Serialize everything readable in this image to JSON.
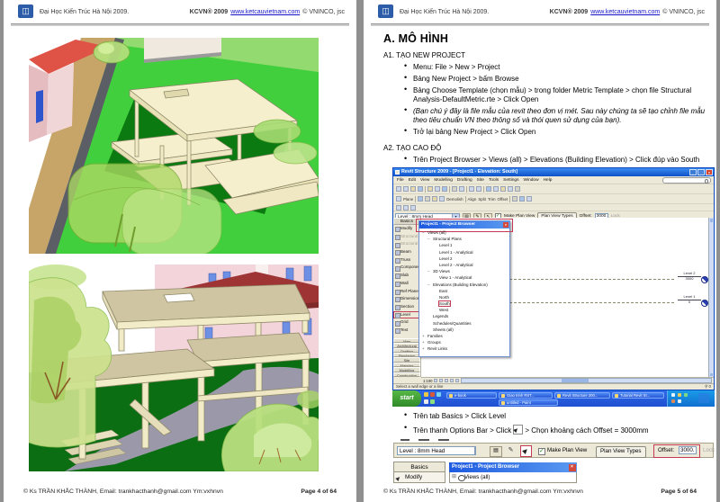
{
  "header": {
    "org": "Đại Học Kiến Trúc Hà Nội 2009.",
    "brand": "KCVN® 2009",
    "site": "www.ketcauvietnam.com",
    "copy": "© VNINCO, jsc"
  },
  "footer": {
    "author": "© Ks TRẦN KHẮC THÀNH, Email: trankhacthanh@gmail.com Ym:vxhnvn",
    "page_left": "Page 4 of 64",
    "page_right": "Page 5 of 64"
  },
  "doc": {
    "h1": "A. MÔ HÌNH",
    "a1_title": "A1. TẠO NEW PROJECT",
    "a1_b1": "Menu: File > New > Project",
    "a1_b2": "Bảng New Project > bấm Browse",
    "a1_b3": "Bảng Choose Template (chọn mẫu) > trong folder Metric Template > chọn file Structural Analysis-DefaultMetric.rte > Click Open",
    "a1_note": "(Bạn chú ý đây là file mẫu của revit theo đơn vị mét. Sau này chúng ta sẽ tạo chỉnh file mẫu theo tiêu chuẩn VN theo thông số và thói quen sử dụng của bạn).",
    "a1_b4": "Trở lại bảng New Project > Click Open",
    "a2_title": "A2. TẠO CAO ĐỘ",
    "a2_b1": "Trên Project Browser > Views (all) > Elevations (Building Elevation) > Click đúp vào South",
    "a2_b2": "Trên tab Basics > Click Level",
    "a2_b3_pre": "Trên thanh Options Bar > Click",
    "a2_b3_post": "> Chọn khoảng cách Offset = 3000mm"
  },
  "revit": {
    "title": "Revit Structure 2009 - [Project1 - Elevation: South]",
    "menus": [
      "File",
      "Edit",
      "View",
      "Modelling",
      "Drafting",
      "Site",
      "Tools",
      "Settings",
      "Window",
      "Help"
    ],
    "toolbar2_labels": [
      "Plane",
      "Demolish",
      "Align",
      "Split",
      "Trim",
      "Offset"
    ],
    "type_selector": "Level : 8mm Head",
    "options": {
      "make_plan_view": "Make Plan View",
      "plan_view_types": "Plan View Types",
      "offset_label": "Offset:",
      "offset_value": "3000.",
      "lock": "Lock"
    },
    "design_bar": {
      "tab": "Basics",
      "items": [
        "Modify",
        "Structural Wall",
        "Structural Column",
        "Beam",
        "Truss",
        "Component",
        "Slab",
        "Wall",
        "Ref Plane",
        "Dimension",
        "Section",
        "Level",
        "Grid",
        "Text"
      ],
      "tabs": [
        "View",
        "Architectural",
        "Drafting",
        "Rendering",
        "Site",
        "Massing",
        "Modelling",
        "Construction"
      ]
    },
    "browser": {
      "title": "Project1 - Project Browser",
      "tree": [
        {
          "label": "Views (all)",
          "d": 0
        },
        {
          "label": "Structural Plans",
          "d": 1
        },
        {
          "label": "Level 1",
          "d": 2
        },
        {
          "label": "Level 1 - Analytical",
          "d": 2
        },
        {
          "label": "Level 2",
          "d": 2
        },
        {
          "label": "Level 2 - Analytical",
          "d": 2
        },
        {
          "label": "3D Views",
          "d": 1
        },
        {
          "label": "View 1 - Analytical",
          "d": 2
        },
        {
          "label": "Elevations (Building Elevation)",
          "d": 1
        },
        {
          "label": "East",
          "d": 2
        },
        {
          "label": "North",
          "d": 2
        },
        {
          "label": "South",
          "d": 2
        },
        {
          "label": "West",
          "d": 2
        },
        {
          "label": "Legends",
          "d": 1
        },
        {
          "label": "Schedules/Quantities",
          "d": 1
        },
        {
          "label": "Sheets (all)",
          "d": 1
        },
        {
          "label": "Families",
          "d": 0
        },
        {
          "label": "Groups",
          "d": 0
        },
        {
          "label": "Revit Links",
          "d": 0
        }
      ]
    },
    "canvas": {
      "levels": [
        {
          "name": "Level 2",
          "elev": "3000"
        },
        {
          "name": "Level 1",
          "elev": "0"
        }
      ]
    },
    "view_bar": {
      "scale": "1:100"
    },
    "status": "Select a wall edge or a line",
    "taskbar": {
      "start": "start",
      "buttons": [
        "e-book",
        "Giao trinh RST...",
        "Revit Structure 200...",
        "Tutorial Revit St..."
      ],
      "button_row2": "untitled - Paint"
    },
    "colors": {
      "highlight": "#c43a52",
      "titlebar": "#0d50c8",
      "taskbar": "#2e6ae8"
    }
  }
}
